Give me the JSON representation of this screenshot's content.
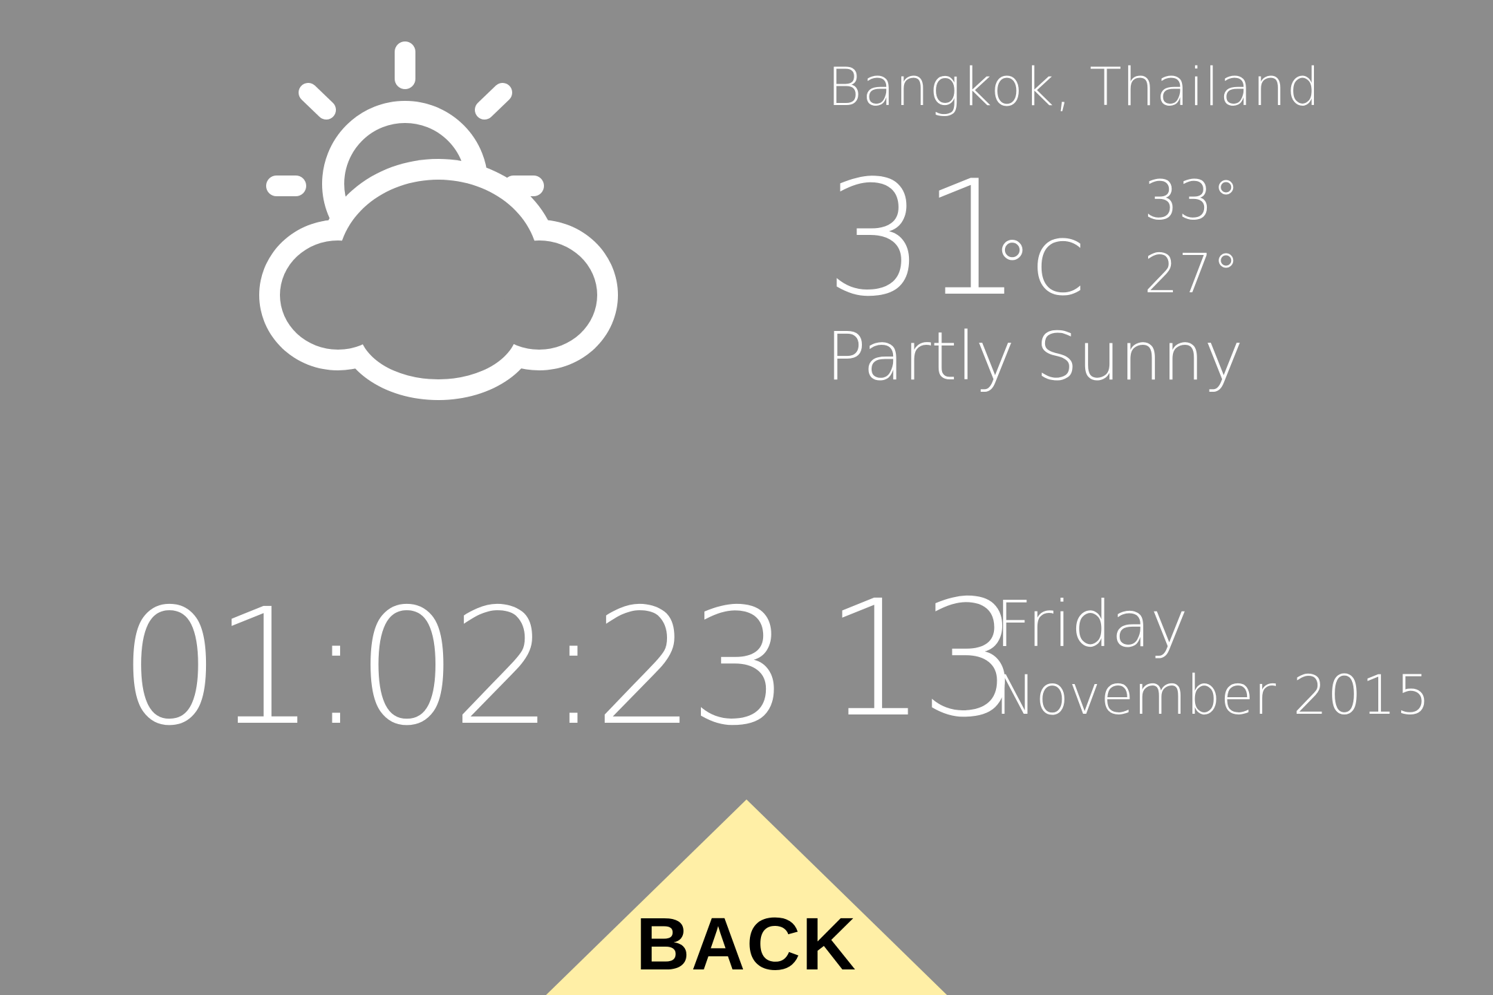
{
  "weather": {
    "icon": "partly-sunny-icon",
    "location": "Bangkok, Thailand",
    "temperature": "31",
    "unit": "°C",
    "high": "33°",
    "low": "27°",
    "condition": "Partly Sunny"
  },
  "datetime": {
    "time": "01:02:23",
    "day": "13",
    "weekday": "Friday",
    "month_year": "November 2015"
  },
  "navigation": {
    "back_label": "BACK"
  },
  "colors": {
    "background": "#8c8c8c",
    "foreground": "#ffffff",
    "back_button": "#ffefa6",
    "back_text": "#000000"
  }
}
